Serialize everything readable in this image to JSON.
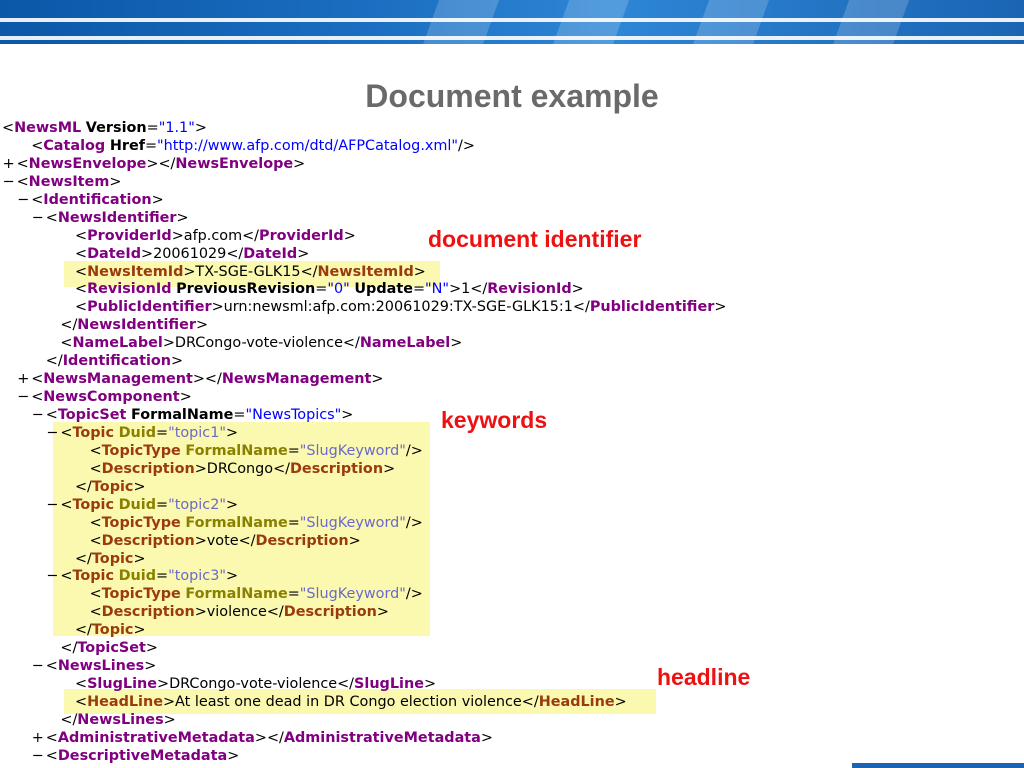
{
  "title": "Document example",
  "annotations": {
    "document_identifier": "document identifier",
    "keywords": "keywords",
    "headline": "headline"
  },
  "xml": {
    "lines": [
      {
        "indent": 0,
        "ctl": "−",
        "segs": [
          [
            "p",
            "<"
          ],
          [
            "t",
            "NewsML"
          ],
          [
            "p",
            " "
          ],
          [
            "a",
            "Version"
          ],
          [
            "p",
            "="
          ],
          [
            "v",
            "\"1.1\""
          ],
          [
            "p",
            ">"
          ]
        ]
      },
      {
        "indent": 2,
        "ctl": "",
        "segs": [
          [
            "p",
            "<"
          ],
          [
            "t",
            "Catalog"
          ],
          [
            "p",
            " "
          ],
          [
            "a",
            "Href"
          ],
          [
            "p",
            "="
          ],
          [
            "v",
            "\"http://www.afp.com/dtd/AFPCatalog.xml\""
          ],
          [
            "p",
            "/>"
          ]
        ]
      },
      {
        "indent": 1,
        "ctl": "+",
        "segs": [
          [
            "p",
            "<"
          ],
          [
            "t",
            "NewsEnvelope"
          ],
          [
            "p",
            "></"
          ],
          [
            "t",
            "NewsEnvelope"
          ],
          [
            "p",
            ">"
          ]
        ]
      },
      {
        "indent": 1,
        "ctl": "−",
        "segs": [
          [
            "p",
            "<"
          ],
          [
            "t",
            "NewsItem"
          ],
          [
            "p",
            ">"
          ]
        ]
      },
      {
        "indent": 2,
        "ctl": "−",
        "segs": [
          [
            "p",
            "<"
          ],
          [
            "t",
            "Identification"
          ],
          [
            "p",
            ">"
          ]
        ]
      },
      {
        "indent": 3,
        "ctl": "−",
        "segs": [
          [
            "p",
            "<"
          ],
          [
            "t",
            "NewsIdentifier"
          ],
          [
            "p",
            ">"
          ]
        ]
      },
      {
        "indent": 5,
        "ctl": "",
        "segs": [
          [
            "p",
            "<"
          ],
          [
            "t",
            "ProviderId"
          ],
          [
            "p",
            ">afp.com</"
          ],
          [
            "t",
            "ProviderId"
          ],
          [
            "p",
            ">"
          ]
        ]
      },
      {
        "indent": 5,
        "ctl": "",
        "segs": [
          [
            "p",
            "<"
          ],
          [
            "t",
            "DateId"
          ],
          [
            "p",
            ">20061029</"
          ],
          [
            "t",
            "DateId"
          ],
          [
            "p",
            ">"
          ]
        ]
      },
      {
        "indent": 5,
        "ctl": "",
        "hl": true,
        "segs": [
          [
            "p",
            "<"
          ],
          [
            "t",
            "NewsItemId"
          ],
          [
            "p",
            ">TX-SGE-GLK15</"
          ],
          [
            "t",
            "NewsItemId"
          ],
          [
            "p",
            ">"
          ]
        ]
      },
      {
        "indent": 5,
        "ctl": "",
        "segs": [
          [
            "p",
            "<"
          ],
          [
            "t",
            "RevisionId"
          ],
          [
            "p",
            " "
          ],
          [
            "a",
            "PreviousRevision"
          ],
          [
            "p",
            "="
          ],
          [
            "v",
            "\"0\""
          ],
          [
            "p",
            " "
          ],
          [
            "a",
            "Update"
          ],
          [
            "p",
            "="
          ],
          [
            "v",
            "\"N\""
          ],
          [
            "p",
            ">1</"
          ],
          [
            "t",
            "RevisionId"
          ],
          [
            "p",
            ">"
          ]
        ]
      },
      {
        "indent": 5,
        "ctl": "",
        "segs": [
          [
            "p",
            "<"
          ],
          [
            "t",
            "PublicIdentifier"
          ],
          [
            "p",
            ">urn:newsml:afp.com:20061029:TX-SGE-GLK15:1</"
          ],
          [
            "t",
            "PublicIdentifier"
          ],
          [
            "p",
            ">"
          ]
        ]
      },
      {
        "indent": 4,
        "ctl": "",
        "segs": [
          [
            "p",
            "</"
          ],
          [
            "t",
            "NewsIdentifier"
          ],
          [
            "p",
            ">"
          ]
        ]
      },
      {
        "indent": 4,
        "ctl": "",
        "segs": [
          [
            "p",
            "<"
          ],
          [
            "t",
            "NameLabel"
          ],
          [
            "p",
            ">DRCongo-vote-violence</"
          ],
          [
            "t",
            "NameLabel"
          ],
          [
            "p",
            ">"
          ]
        ]
      },
      {
        "indent": 3,
        "ctl": "",
        "segs": [
          [
            "p",
            "</"
          ],
          [
            "t",
            "Identification"
          ],
          [
            "p",
            ">"
          ]
        ]
      },
      {
        "indent": 2,
        "ctl": "+",
        "segs": [
          [
            "p",
            "<"
          ],
          [
            "t",
            "NewsManagement"
          ],
          [
            "p",
            "></"
          ],
          [
            "t",
            "NewsManagement"
          ],
          [
            "p",
            ">"
          ]
        ]
      },
      {
        "indent": 2,
        "ctl": "−",
        "segs": [
          [
            "p",
            "<"
          ],
          [
            "t",
            "NewsComponent"
          ],
          [
            "p",
            ">"
          ]
        ]
      },
      {
        "indent": 3,
        "ctl": "−",
        "segs": [
          [
            "p",
            "<"
          ],
          [
            "t",
            "TopicSet"
          ],
          [
            "p",
            " "
          ],
          [
            "a",
            "FormalName"
          ],
          [
            "p",
            "="
          ],
          [
            "v",
            "\"NewsTopics\""
          ],
          [
            "p",
            ">"
          ]
        ]
      },
      {
        "indent": 4,
        "ctl": "−",
        "hl": true,
        "segs": [
          [
            "p",
            "<"
          ],
          [
            "t",
            "Topic"
          ],
          [
            "p",
            " "
          ],
          [
            "a",
            "Duid"
          ],
          [
            "p",
            "="
          ],
          [
            "v",
            "\"topic1\""
          ],
          [
            "p",
            ">"
          ]
        ]
      },
      {
        "indent": 6,
        "ctl": "",
        "hl": true,
        "segs": [
          [
            "p",
            "<"
          ],
          [
            "t",
            "TopicType"
          ],
          [
            "p",
            " "
          ],
          [
            "a",
            "FormalName"
          ],
          [
            "p",
            "="
          ],
          [
            "v",
            "\"SlugKeyword\""
          ],
          [
            "p",
            "/>"
          ]
        ]
      },
      {
        "indent": 6,
        "ctl": "",
        "hl": true,
        "segs": [
          [
            "p",
            "<"
          ],
          [
            "t",
            "Description"
          ],
          [
            "p",
            ">DRCongo</"
          ],
          [
            "t",
            "Description"
          ],
          [
            "p",
            ">"
          ]
        ]
      },
      {
        "indent": 5,
        "ctl": "",
        "hl": true,
        "segs": [
          [
            "p",
            "</"
          ],
          [
            "t",
            "Topic"
          ],
          [
            "p",
            ">"
          ]
        ]
      },
      {
        "indent": 4,
        "ctl": "−",
        "hl": true,
        "segs": [
          [
            "p",
            "<"
          ],
          [
            "t",
            "Topic"
          ],
          [
            "p",
            " "
          ],
          [
            "a",
            "Duid"
          ],
          [
            "p",
            "="
          ],
          [
            "v",
            "\"topic2\""
          ],
          [
            "p",
            ">"
          ]
        ]
      },
      {
        "indent": 6,
        "ctl": "",
        "hl": true,
        "segs": [
          [
            "p",
            "<"
          ],
          [
            "t",
            "TopicType"
          ],
          [
            "p",
            " "
          ],
          [
            "a",
            "FormalName"
          ],
          [
            "p",
            "="
          ],
          [
            "v",
            "\"SlugKeyword\""
          ],
          [
            "p",
            "/>"
          ]
        ]
      },
      {
        "indent": 6,
        "ctl": "",
        "hl": true,
        "segs": [
          [
            "p",
            "<"
          ],
          [
            "t",
            "Description"
          ],
          [
            "p",
            ">vote</"
          ],
          [
            "t",
            "Description"
          ],
          [
            "p",
            ">"
          ]
        ]
      },
      {
        "indent": 5,
        "ctl": "",
        "hl": true,
        "segs": [
          [
            "p",
            "</"
          ],
          [
            "t",
            "Topic"
          ],
          [
            "p",
            ">"
          ]
        ]
      },
      {
        "indent": 4,
        "ctl": "−",
        "hl": true,
        "segs": [
          [
            "p",
            "<"
          ],
          [
            "t",
            "Topic"
          ],
          [
            "p",
            " "
          ],
          [
            "a",
            "Duid"
          ],
          [
            "p",
            "="
          ],
          [
            "v",
            "\"topic3\""
          ],
          [
            "p",
            ">"
          ]
        ]
      },
      {
        "indent": 6,
        "ctl": "",
        "hl": true,
        "segs": [
          [
            "p",
            "<"
          ],
          [
            "t",
            "TopicType"
          ],
          [
            "p",
            " "
          ],
          [
            "a",
            "FormalName"
          ],
          [
            "p",
            "="
          ],
          [
            "v",
            "\"SlugKeyword\""
          ],
          [
            "p",
            "/>"
          ]
        ]
      },
      {
        "indent": 6,
        "ctl": "",
        "hl": true,
        "segs": [
          [
            "p",
            "<"
          ],
          [
            "t",
            "Description"
          ],
          [
            "p",
            ">violence</"
          ],
          [
            "t",
            "Description"
          ],
          [
            "p",
            ">"
          ]
        ]
      },
      {
        "indent": 5,
        "ctl": "",
        "hl": true,
        "segs": [
          [
            "p",
            "</"
          ],
          [
            "t",
            "Topic"
          ],
          [
            "p",
            ">"
          ]
        ]
      },
      {
        "indent": 4,
        "ctl": "",
        "segs": [
          [
            "p",
            "</"
          ],
          [
            "t",
            "TopicSet"
          ],
          [
            "p",
            ">"
          ]
        ]
      },
      {
        "indent": 3,
        "ctl": "−",
        "segs": [
          [
            "p",
            "<"
          ],
          [
            "t",
            "NewsLines"
          ],
          [
            "p",
            ">"
          ]
        ]
      },
      {
        "indent": 5,
        "ctl": "",
        "segs": [
          [
            "p",
            "<"
          ],
          [
            "t",
            "SlugLine"
          ],
          [
            "p",
            ">DRCongo-vote-violence</"
          ],
          [
            "t",
            "SlugLine"
          ],
          [
            "p",
            ">"
          ]
        ]
      },
      {
        "indent": 5,
        "ctl": "",
        "hl": true,
        "segs": [
          [
            "p",
            "<"
          ],
          [
            "t",
            "HeadLine"
          ],
          [
            "p",
            ">At least one dead in DR Congo election violence</"
          ],
          [
            "t",
            "HeadLine"
          ],
          [
            "p",
            ">"
          ]
        ]
      },
      {
        "indent": 4,
        "ctl": "",
        "segs": [
          [
            "p",
            "</"
          ],
          [
            "t",
            "NewsLines"
          ],
          [
            "p",
            ">"
          ]
        ]
      },
      {
        "indent": 3,
        "ctl": "+",
        "segs": [
          [
            "p",
            "<"
          ],
          [
            "t",
            "AdministrativeMetadata"
          ],
          [
            "p",
            "></"
          ],
          [
            "t",
            "AdministrativeMetadata"
          ],
          [
            "p",
            ">"
          ]
        ]
      },
      {
        "indent": 3,
        "ctl": "−",
        "segs": [
          [
            "p",
            "<"
          ],
          [
            "t",
            "DescriptiveMetadata"
          ],
          [
            "p",
            ">"
          ]
        ]
      }
    ]
  }
}
